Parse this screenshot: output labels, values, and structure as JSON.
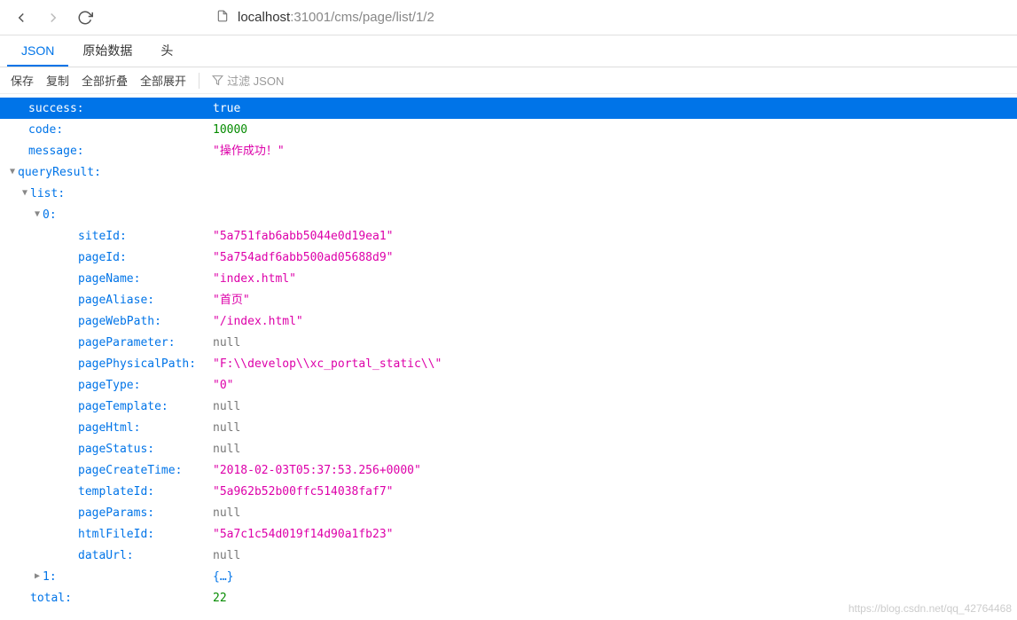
{
  "browser": {
    "url_host": "localhost",
    "url_port_path": ":31001/cms/page/list/1/2"
  },
  "tabs": {
    "json": "JSON",
    "raw": "原始数据",
    "headers": "头"
  },
  "actions": {
    "save": "保存",
    "copy": "复制",
    "collapse_all": "全部折叠",
    "expand_all": "全部展开",
    "filter_placeholder": "过滤 JSON"
  },
  "json": {
    "success": {
      "key": "success",
      "value": "true"
    },
    "code": {
      "key": "code",
      "value": "10000"
    },
    "message": {
      "key": "message",
      "value": "\"操作成功！\""
    },
    "queryResult": {
      "key": "queryResult"
    },
    "list": {
      "key": "list"
    },
    "idx0": {
      "key": "0"
    },
    "fields": [
      {
        "key": "siteId",
        "value": "\"5a751fab6abb5044e0d19ea1\"",
        "type": "str"
      },
      {
        "key": "pageId",
        "value": "\"5a754adf6abb500ad05688d9\"",
        "type": "str"
      },
      {
        "key": "pageName",
        "value": "\"index.html\"",
        "type": "str"
      },
      {
        "key": "pageAliase",
        "value": "\"首页\"",
        "type": "str"
      },
      {
        "key": "pageWebPath",
        "value": "\"/index.html\"",
        "type": "str"
      },
      {
        "key": "pageParameter",
        "value": "null",
        "type": "null"
      },
      {
        "key": "pagePhysicalPath",
        "value": "\"F:\\\\develop\\\\xc_portal_static\\\\\"",
        "type": "str"
      },
      {
        "key": "pageType",
        "value": "\"0\"",
        "type": "str"
      },
      {
        "key": "pageTemplate",
        "value": "null",
        "type": "null"
      },
      {
        "key": "pageHtml",
        "value": "null",
        "type": "null"
      },
      {
        "key": "pageStatus",
        "value": "null",
        "type": "null"
      },
      {
        "key": "pageCreateTime",
        "value": "\"2018-02-03T05:37:53.256+0000\"",
        "type": "str"
      },
      {
        "key": "templateId",
        "value": "\"5a962b52b00ffc514038faf7\"",
        "type": "str"
      },
      {
        "key": "pageParams",
        "value": "null",
        "type": "null"
      },
      {
        "key": "htmlFileId",
        "value": "\"5a7c1c54d019f14d90a1fb23\"",
        "type": "str"
      },
      {
        "key": "dataUrl",
        "value": "null",
        "type": "null"
      }
    ],
    "idx1": {
      "key": "1",
      "value": "{…}"
    },
    "total": {
      "key": "total",
      "value": "22"
    }
  },
  "watermark": "https://blog.csdn.net/qq_42764468"
}
